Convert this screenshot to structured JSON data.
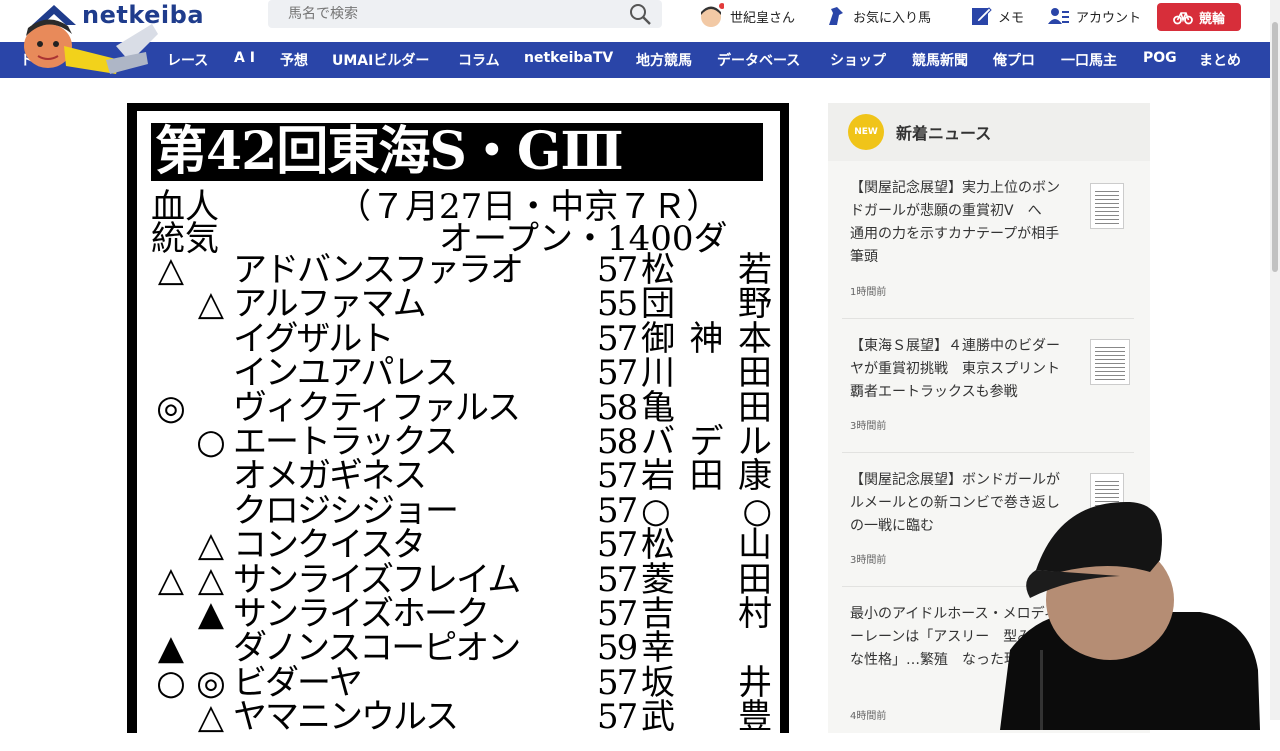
{
  "header": {
    "logo_text": "netkeiba",
    "search_placeholder": "馬名で検索",
    "user_name": "世紀皇さん",
    "favorites": "お気に入り馬",
    "memo": "メモ",
    "account": "アカウント",
    "keirin": "競輪"
  },
  "nav": {
    "items": [
      "トップ",
      "レース",
      "A I",
      "予想",
      "UMAIビルダー",
      "コラム",
      "netkeibaTV",
      "地方競馬",
      "データベース",
      "ショップ",
      "競馬新聞",
      "俺プロ",
      "一口馬主",
      "POG",
      "まとめ"
    ]
  },
  "article": {
    "race_title": "第42回東海S・GⅢ",
    "col_label_1": "血人",
    "col_label_2": "統気",
    "race_date": "（７月27日・中京７Ｒ）",
    "race_class": "オープン・1400ダ",
    "entries": [
      {
        "m1": "△",
        "m2": "",
        "name": "アドバンスファラオ",
        "weight": "57",
        "jockey": "松若"
      },
      {
        "m1": "",
        "m2": "△",
        "name": "アルファマム",
        "weight": "55",
        "jockey": "団野"
      },
      {
        "m1": "",
        "m2": "",
        "name": "イグザルト",
        "weight": "57",
        "jockey": "御神本"
      },
      {
        "m1": "",
        "m2": "",
        "name": "インユアパレス",
        "weight": "57",
        "jockey": "川田"
      },
      {
        "m1": "◎",
        "m2": "",
        "name": "ヴィクティファルス",
        "weight": "58",
        "jockey": "亀田"
      },
      {
        "m1": "",
        "m2": "○",
        "name": "エートラックス",
        "weight": "58",
        "jockey": "バデル"
      },
      {
        "m1": "",
        "m2": "",
        "name": "オメガギネス",
        "weight": "57",
        "jockey": "岩田康"
      },
      {
        "m1": "",
        "m2": "",
        "name": "クロジシジョー",
        "weight": "57",
        "jockey": "○○"
      },
      {
        "m1": "",
        "m2": "△",
        "name": "コンクイスタ",
        "weight": "57",
        "jockey": "松山"
      },
      {
        "m1": "△",
        "m2": "△",
        "name": "サンライズフレイム",
        "weight": "57",
        "jockey": "菱田"
      },
      {
        "m1": "",
        "m2": "▲",
        "name": "サンライズホーク",
        "weight": "57",
        "jockey": "吉村"
      },
      {
        "m1": "▲",
        "m2": "",
        "name": "ダノンスコーピオン",
        "weight": "59",
        "jockey": "幸"
      },
      {
        "m1": "○",
        "m2": "◎",
        "name": "ビダーヤ",
        "weight": "57",
        "jockey": "坂井"
      },
      {
        "m1": "",
        "m2": "△",
        "name": "ヤマニンウルス",
        "weight": "57",
        "jockey": "武豊"
      }
    ]
  },
  "sidebar": {
    "badge": "NEW",
    "title": "新着ニュース",
    "news": [
      {
        "text": "【関屋記念展望】実力上位のボンドガールが悲願の重賞初V　へ　通用の力を示すカナテープが相手筆頭",
        "time": "1時間前"
      },
      {
        "text": "【東海Ｓ展望】４連勝中のビダーヤが重賞初挑戦　東京スプリント覇者エートラックスも参戦",
        "time": "3時間前"
      },
      {
        "text": "【関屋記念展望】ボンドガールがルメールとの新コンビで巻き返しの一戦に臨む",
        "time": "3時間前"
      },
      {
        "text": "最小のアイドルホース・メロディーレーンは「アスリー　型みたいな性格」…繁殖　なった現在",
        "time": "4時間前"
      }
    ]
  },
  "colors": {
    "nav_bg": "#2a45a8",
    "logo": "#1f3c8c",
    "keirin_btn": "#d72e3a",
    "new_badge": "#f0c419"
  }
}
